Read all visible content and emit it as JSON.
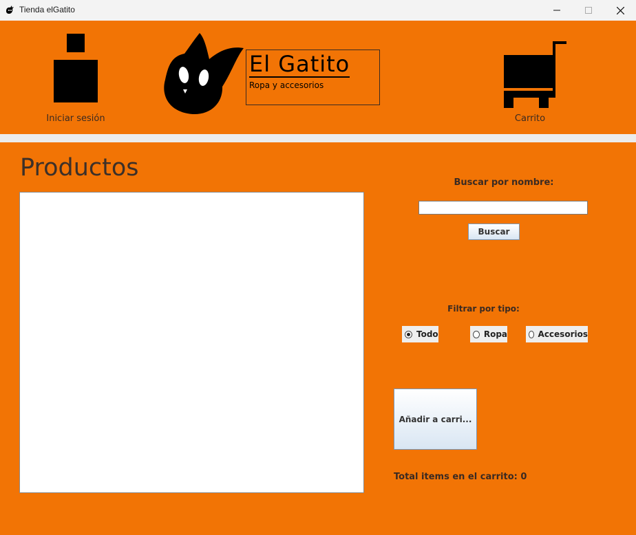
{
  "window": {
    "title": "Tienda elGatito"
  },
  "header": {
    "login_label": "Iniciar sesión",
    "cart_label": "Carrito",
    "brand_name": "El Gatito",
    "brand_tagline": "Ropa y accesorios"
  },
  "main": {
    "title": "Productos",
    "products": [],
    "search": {
      "label": "Buscar por nombre:",
      "value": "",
      "button": "Buscar"
    },
    "filter": {
      "label": "Filtrar por tipo:",
      "options": [
        "Todo",
        "Ropa",
        "Accesorios"
      ],
      "selected": "Todo"
    },
    "add_button": "Añadir a carri...",
    "total_text": "Total items en el carrito: 0"
  },
  "colors": {
    "background": "#f27405",
    "text": "#3a2a22"
  }
}
